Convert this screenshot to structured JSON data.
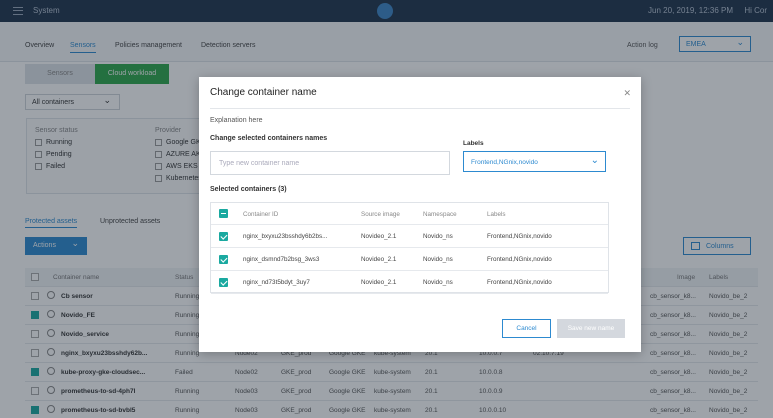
{
  "topbar": {
    "system": "System",
    "date": "Jun 20, 2019, 12:36 PM",
    "user": "Hi Cor"
  },
  "nav": {
    "tabs": [
      "Overview",
      "Sensors",
      "Policies management",
      "Detection servers"
    ],
    "active_tab": "Sensors",
    "action_log": "Action log",
    "region": "EMEA"
  },
  "subtabs": {
    "sensors": "Sensors",
    "cloud_workload": "Cloud workload"
  },
  "containers_filter": "All containers",
  "filters": {
    "sensor_status_title": "Sensor status",
    "statuses": [
      "Running",
      "Pending",
      "Failed"
    ],
    "provider_title": "Provider",
    "providers": [
      "Google GKE",
      "AZURE AKS",
      "AWS EKS",
      "Kubernetes"
    ]
  },
  "asset_tabs": {
    "protected": "Protected assets",
    "unprotected": "Unprotected assets"
  },
  "actions_button": "Actions",
  "columns_button": "Columns",
  "main_table": {
    "headers": {
      "name": "Container name",
      "status": "Status",
      "image": "Image",
      "labels": "Labels"
    },
    "rows": [
      {
        "name": "Cb sensor",
        "status": "Running",
        "cols": [
          "",
          "",
          "",
          "",
          "",
          "",
          ""
        ],
        "image": "cb_sensor_k8...",
        "labels": "Novido_be_2",
        "checked": false
      },
      {
        "name": "Novido_FE",
        "status": "Running",
        "cols": [
          "",
          "",
          "",
          "",
          "",
          "",
          ""
        ],
        "image": "cb_sensor_k8...",
        "labels": "Novido_be_2",
        "checked": true
      },
      {
        "name": "Novido_service",
        "status": "Running",
        "cols": [
          "",
          "",
          "",
          "",
          "",
          "",
          ""
        ],
        "image": "cb_sensor_k8...",
        "labels": "Novido_be_2",
        "checked": false
      },
      {
        "name": "nginx_bxyxu23bsshdy62b...",
        "status": "Running",
        "cols": [
          "Node02",
          "GKE_prod",
          "Google GKE",
          "kube-system",
          "20.1",
          "10.0.0.7",
          "02:10:7:19"
        ],
        "image": "cb_sensor_k8...",
        "labels": "Novido_be_2",
        "checked": false
      },
      {
        "name": "kube-proxy-gke-cloudsec...",
        "status": "Failed",
        "cols": [
          "Node02",
          "GKE_prod",
          "Google GKE",
          "kube-system",
          "20.1",
          "10.0.0.8",
          ""
        ],
        "image": "cb_sensor_k8...",
        "labels": "Novido_be_2",
        "checked": true
      },
      {
        "name": "prometheus-to-sd-4ph7l",
        "status": "Running",
        "cols": [
          "Node03",
          "GKE_prod",
          "Google GKE",
          "kube-system",
          "20.1",
          "10.0.0.9",
          ""
        ],
        "image": "cb_sensor_k8...",
        "labels": "Novido_be_2",
        "checked": false
      },
      {
        "name": "prometheus-to-sd-bvbl5",
        "status": "Running",
        "cols": [
          "Node03",
          "GKE_prod",
          "Google GKE",
          "kube-system",
          "20.1",
          "10.0.0.10",
          ""
        ],
        "image": "cb_sensor_k8...",
        "labels": "Novido_be_2",
        "checked": true
      }
    ]
  },
  "modal": {
    "title": "Change container name",
    "explanation": "Explanation here",
    "names_label": "Change selected containers names",
    "name_placeholder": "Type new container name",
    "labels_label": "Labels",
    "labels_value": "Frontend,NGnix,novido",
    "selected_label": "Selected containers (3)",
    "table": {
      "headers": [
        "Container ID",
        "Source image",
        "Namespace",
        "Labels"
      ],
      "rows": [
        {
          "id": "nginx_bxyxu23bsshdy6b2bs...",
          "image": "Novideo_2.1",
          "namespace": "Novido_ns",
          "labels": "Frontend,NGnix,novido"
        },
        {
          "id": "nginx_dsmnd7b2bsg_3ws3",
          "image": "Novideo_2.1",
          "namespace": "Novido_ns",
          "labels": "Frontend,NGnix,novido"
        },
        {
          "id": "nginx_nd73t5bdyt_3uy7",
          "image": "Novideo_2.1",
          "namespace": "Novido_ns",
          "labels": "Frontend,NGnix,novido"
        }
      ]
    },
    "cancel": "Cancel",
    "save": "Save new name"
  },
  "colors": {
    "accent": "#2d8ad0",
    "green": "#2ea84a",
    "teal": "#1aa9a0",
    "topbar": "#20344d"
  }
}
